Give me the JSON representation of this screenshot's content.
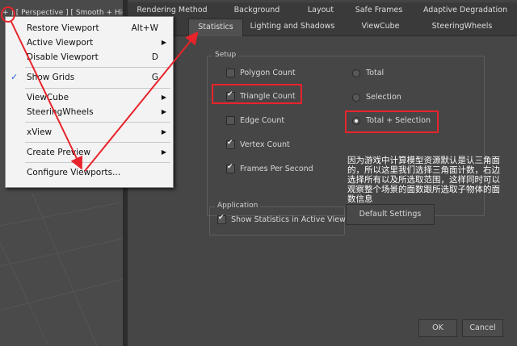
{
  "viewport": {
    "label": "+ ] [ Perspective ] [ Smooth + Highlight"
  },
  "tabs_row1": [
    "Rendering Method",
    "Background",
    "Layout",
    "Safe Frames",
    "Adaptive Degradation"
  ],
  "tabs_row2": [
    "Statistics",
    "Lighting and Shadows",
    "ViewCube",
    "SteeringWheels"
  ],
  "setup": {
    "title": "Setup",
    "checks": [
      {
        "label": "Polygon Count",
        "checked": false
      },
      {
        "label": "Triangle Count",
        "checked": true
      },
      {
        "label": "Edge Count",
        "checked": false
      },
      {
        "label": "Vertex Count",
        "checked": true
      },
      {
        "label": "Frames Per Second",
        "checked": true
      }
    ],
    "radios": [
      {
        "label": "Total",
        "checked": false
      },
      {
        "label": "Selection",
        "checked": false
      },
      {
        "label": "Total + Selection",
        "checked": true
      }
    ]
  },
  "application": {
    "title": "Application",
    "show_stats_label": "Show Statistics in Active View",
    "show_stats_checked": true
  },
  "buttons": {
    "defaults": "Default Settings",
    "ok": "OK",
    "cancel": "Cancel"
  },
  "annotation": "因为游戏中计算模型资源默认是认三角面的，所以这里我们选择三角面计数，右边选择所有以及所选取范围，这样同时可以观察整个场景的面数跟所选取子物体的面数信息",
  "menu": {
    "items": [
      {
        "label": "Restore Viewport",
        "shortcut": "Alt+W"
      },
      {
        "label": "Active Viewport",
        "submenu": "▶"
      },
      {
        "label": "Disable Viewport",
        "shortcut": "D"
      },
      {
        "label": "Show Grids",
        "shortcut": "G",
        "check": "✓"
      },
      {
        "label": "ViewCube",
        "submenu": "▶"
      },
      {
        "label": "SteeringWheels",
        "submenu": "▶"
      },
      {
        "label": "xView",
        "submenu": "▶"
      },
      {
        "label": "Create Preview",
        "submenu": "▶"
      },
      {
        "label": "Configure Viewports..."
      }
    ]
  },
  "colors": {
    "highlight": "#e8232b",
    "dialog_bg": "#464646",
    "menu_bg": "#f3f3f3"
  }
}
